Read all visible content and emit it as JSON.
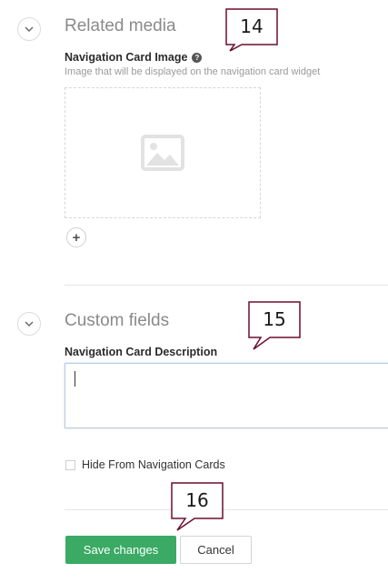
{
  "sections": {
    "related_media": {
      "title": "Related media",
      "image_field_label": "Navigation Card Image",
      "image_field_help": "Image that will be displayed on the navigation card widget",
      "help_icon_glyph": "?",
      "add_icon_glyph": "+"
    },
    "custom_fields": {
      "title": "Custom fields",
      "description_label": "Navigation Card Description",
      "description_value": "",
      "hide_checkbox_label": "Hide From Navigation Cards",
      "hide_checkbox_checked": false
    }
  },
  "actions": {
    "save_label": "Save changes",
    "cancel_label": "Cancel"
  },
  "callouts": {
    "c14": "14",
    "c15": "15",
    "c16": "16"
  },
  "colors": {
    "primary_green": "#3aaa64",
    "callout_border": "#6b0f2e"
  },
  "icons": {
    "collapse": "chevron-down-icon",
    "placeholder": "image-placeholder-icon",
    "help": "question-circle-icon",
    "add": "plus-icon"
  }
}
